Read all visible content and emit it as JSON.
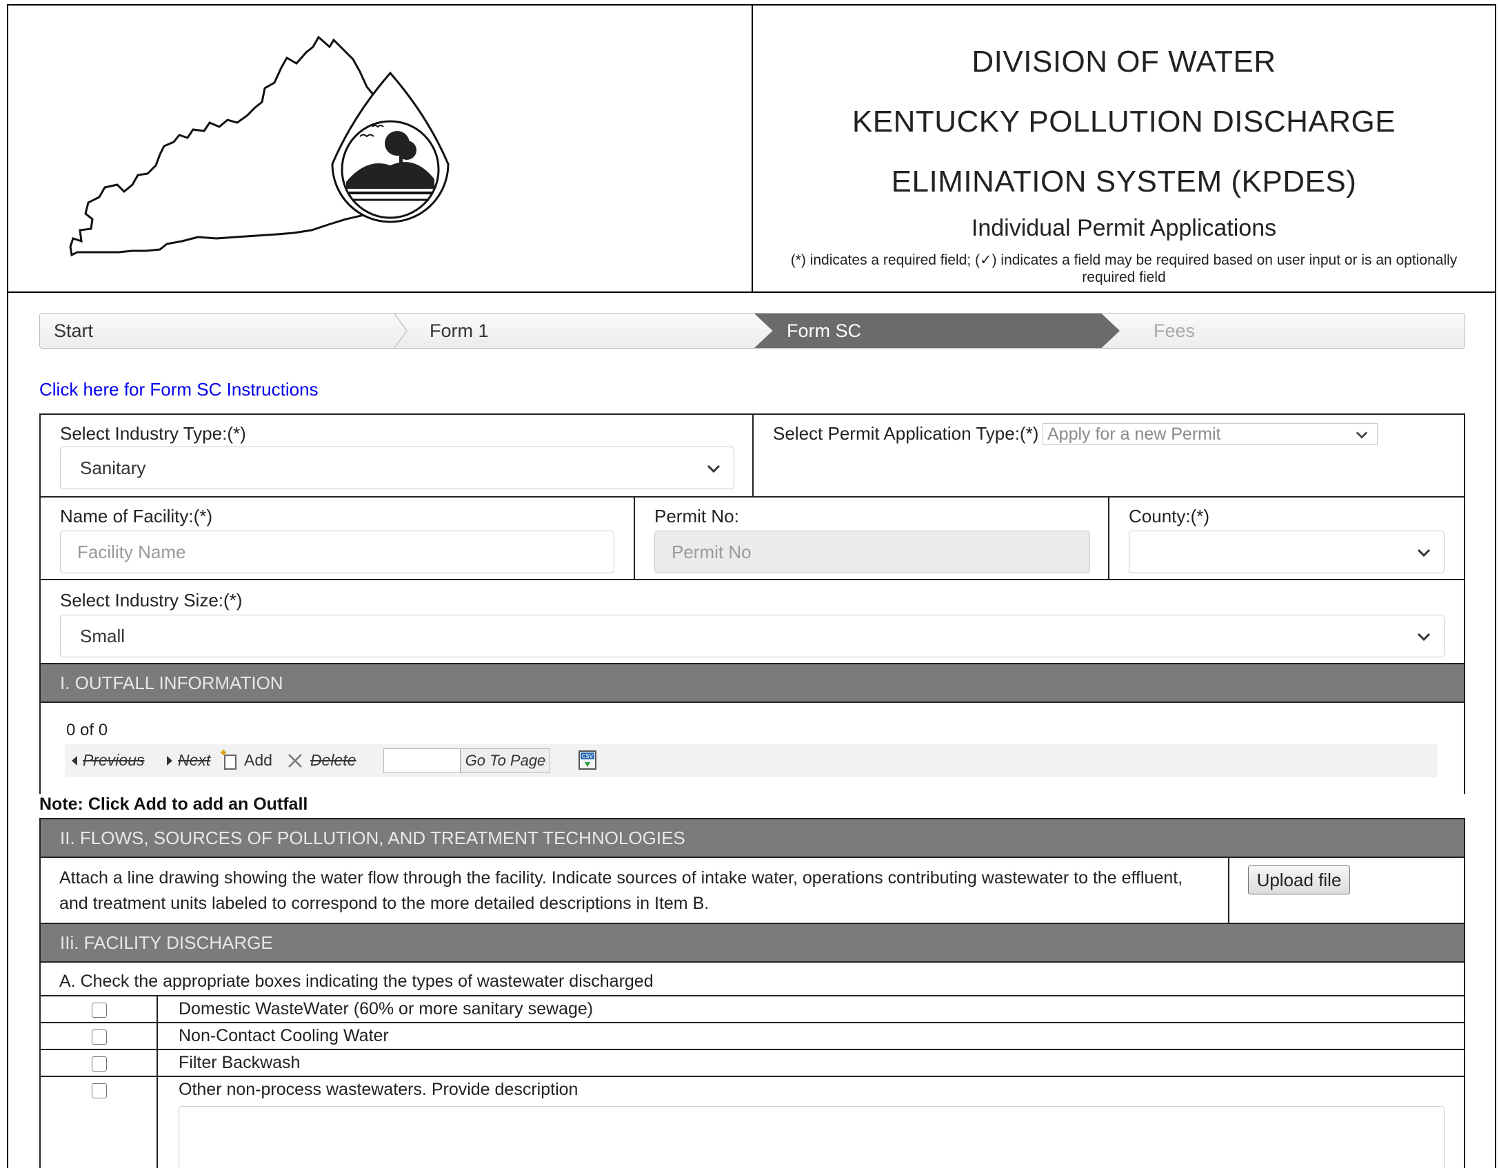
{
  "header": {
    "title_line1": "DIVISION OF WATER",
    "title_line2": "KENTUCKY POLLUTION DISCHARGE",
    "title_line3": "ELIMINATION SYSTEM (KPDES)",
    "subtitle": "Individual Permit Applications",
    "required_note": "(*) indicates a required field; (✓) indicates a field may be required based on user input or is an optionally required field"
  },
  "wizard": {
    "steps": [
      {
        "label": "Start",
        "state": "done"
      },
      {
        "label": "Form 1",
        "state": "done"
      },
      {
        "label": "Form SC",
        "state": "active"
      },
      {
        "label": "Fees",
        "state": "disabled"
      }
    ]
  },
  "instructions_link": "Click here for Form SC Instructions",
  "form": {
    "industry_type_label": "Select Industry Type:(*)",
    "industry_type_value": "Sanitary",
    "permit_app_type_label": "Select Permit Application Type:(*)",
    "permit_app_type_value": "Apply for a new Permit",
    "facility_name_label": "Name of Facility:(*)",
    "facility_name_placeholder": "Facility Name",
    "permit_no_label": "Permit No:",
    "permit_no_placeholder": "Permit No",
    "county_label": "County:(*)",
    "county_value": "",
    "industry_size_label": "Select Industry Size:(*)",
    "industry_size_value": "Small"
  },
  "section1": {
    "title": "I. OUTFALL INFORMATION",
    "count": "0 of 0",
    "toolbar": {
      "previous": "Previous",
      "next": "Next",
      "add": "Add",
      "delete": "Delete",
      "goto": "Go To Page",
      "csv_icon": "csv-export-icon"
    },
    "note": "Note: Click Add to add an Outfall"
  },
  "section2": {
    "title": "II. FLOWS, SOURCES OF POLLUTION, AND TREATMENT TECHNOLOGIES",
    "description": "Attach a line drawing showing the water flow through the facility. Indicate sources of intake water, operations contributing wastewater to the effluent, and treatment units labeled to correspond to the more detailed descriptions in Item B.",
    "upload_label": "Upload file"
  },
  "section3": {
    "title": "IIi. FACILITY DISCHARGE",
    "instruction": "A. Check the appropriate boxes indicating the types of wastewater discharged",
    "options": [
      {
        "label": "Domestic WasteWater (60% or more sanitary sewage)",
        "checked": false
      },
      {
        "label": "Non-Contact Cooling Water",
        "checked": false
      },
      {
        "label": "Filter Backwash",
        "checked": false
      },
      {
        "label": "Other non-process wastewaters. Provide description",
        "checked": false
      }
    ]
  },
  "colors": {
    "section_bar": "#7b7b7b",
    "active_step": "#6b6b6b",
    "link": "#0000ee"
  }
}
